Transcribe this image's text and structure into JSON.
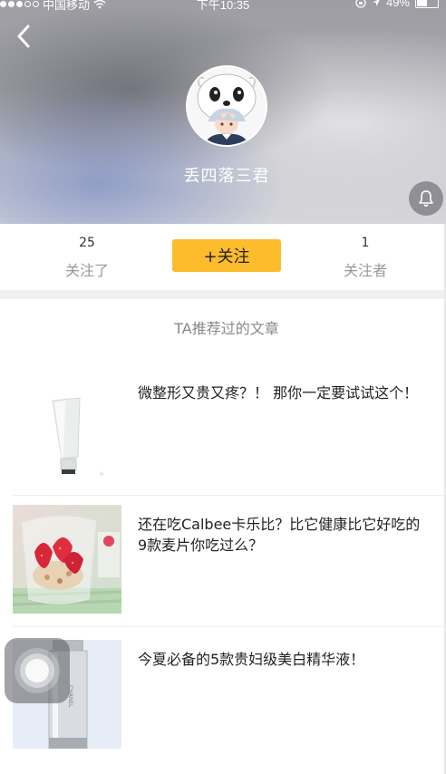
{
  "status_bar": {
    "carrier": "中国移动",
    "time": "下午10:35",
    "battery_level": 0.49,
    "battery_text": "49%"
  },
  "header": {
    "back_icon": "chevron-left-icon",
    "username": "丢四落三君",
    "bell_icon": "bell-icon"
  },
  "stats": {
    "following_count": "25",
    "following_label": "关注了",
    "follow_button_label": "+关注",
    "followers_count": "1",
    "followers_label": "关注者"
  },
  "section_title": "TA推荐过的文章",
  "articles": [
    {
      "title": "微整形又贵又疼？！ 那你一定要试试这个！",
      "thumb": "skincare-tube"
    },
    {
      "title": "还在吃Calbee卡乐比？比它健康比它好吃的9款麦片你吃过么？",
      "thumb": "strawberry-yogurt-cup"
    },
    {
      "title": "今夏必备的5款贵妇级美白精华液！",
      "thumb": "serum-bottle"
    }
  ],
  "colors": {
    "accent": "#fdbc2c",
    "muted_text": "#999999",
    "divider": "#f0f0f0"
  }
}
